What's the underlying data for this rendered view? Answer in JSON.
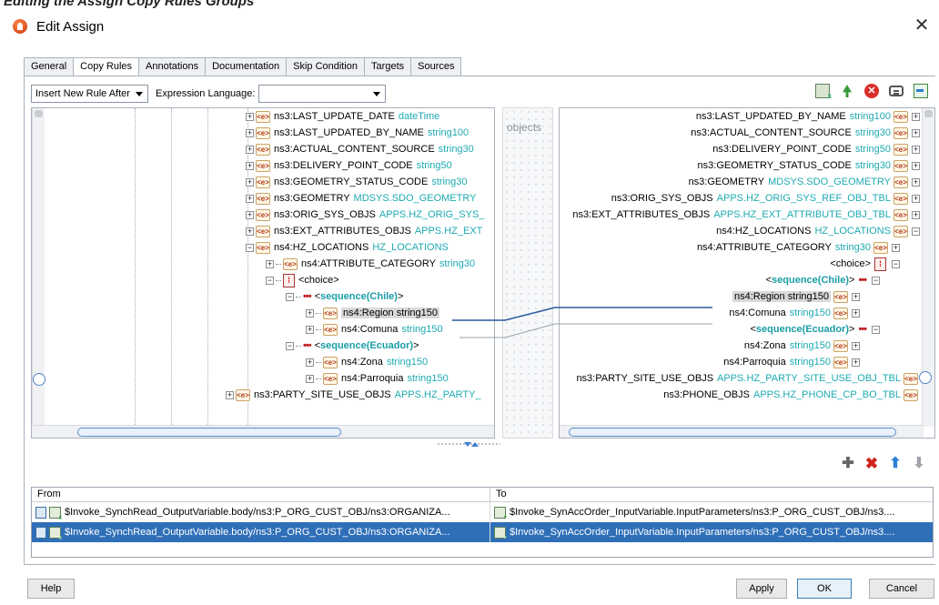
{
  "caption": "Editing the Assign Copy Rules Groups",
  "window": {
    "title": "Edit Assign",
    "close_glyph": "✕"
  },
  "tabs": [
    "General",
    "Copy Rules",
    "Annotations",
    "Documentation",
    "Skip Condition",
    "Targets",
    "Sources"
  ],
  "active_tab": "Copy Rules",
  "toolbar": {
    "insert_mode": "Insert New Rule After",
    "expression_language_label": "Expression Language:",
    "expression_language_value": ""
  },
  "middle": {
    "label": "objects"
  },
  "source_tree": [
    {
      "name": "ns3:LAST_UPDATE_DATE",
      "type": "dateTime"
    },
    {
      "name": "ns3:LAST_UPDATED_BY_NAME",
      "type": "string100"
    },
    {
      "name": "ns3:ACTUAL_CONTENT_SOURCE",
      "type": "string30"
    },
    {
      "name": "ns3:DELIVERY_POINT_CODE",
      "type": "string50"
    },
    {
      "name": "ns3:GEOMETRY_STATUS_CODE",
      "type": "string30"
    },
    {
      "name": "ns3:GEOMETRY",
      "type": "MDSYS.SDO_GEOMETRY"
    },
    {
      "name": "ns3:ORIG_SYS_OBJS",
      "type": "APPS.HZ_ORIG_SYS_"
    },
    {
      "name": "ns3:EXT_ATTRIBUTES_OBJS",
      "type": "APPS.HZ_EXT"
    },
    {
      "name": "ns4:HZ_LOCATIONS",
      "type": "HZ_LOCATIONS"
    },
    {
      "name": "ns4:ATTRIBUTE_CATEGORY",
      "type": "string30"
    },
    {
      "name": "<choice>",
      "type": ""
    },
    {
      "name": "<sequence(Chile)>",
      "type": ""
    },
    {
      "name": "ns4:Region",
      "type": "string150"
    },
    {
      "name": "ns4:Comuna",
      "type": "string150"
    },
    {
      "name": "<sequence(Ecuador)>",
      "type": ""
    },
    {
      "name": "ns4:Zona",
      "type": "string150"
    },
    {
      "name": "ns4:Parroquia",
      "type": "string150"
    },
    {
      "name": "ns3:PARTY_SITE_USE_OBJS",
      "type": "APPS.HZ_PARTY_"
    }
  ],
  "target_tree": [
    {
      "name": "ns3:LAST_UPDATED_BY_NAME",
      "type": "string100"
    },
    {
      "name": "ns3:ACTUAL_CONTENT_SOURCE",
      "type": "string30"
    },
    {
      "name": "ns3:DELIVERY_POINT_CODE",
      "type": "string50"
    },
    {
      "name": "ns3:GEOMETRY_STATUS_CODE",
      "type": "string30"
    },
    {
      "name": "ns3:GEOMETRY",
      "type": "MDSYS.SDO_GEOMETRY"
    },
    {
      "name": "ns3:ORIG_SYS_OBJS",
      "type": "APPS.HZ_ORIG_SYS_REF_OBJ_TBL"
    },
    {
      "name": "ns3:EXT_ATTRIBUTES_OBJS",
      "type": "APPS.HZ_EXT_ATTRIBUTE_OBJ_TBL"
    },
    {
      "name": "ns4:HZ_LOCATIONS",
      "type": "HZ_LOCATIONS"
    },
    {
      "name": "ns4:ATTRIBUTE_CATEGORY",
      "type": "string30"
    },
    {
      "name": "<choice>",
      "type": ""
    },
    {
      "name": "<sequence(Chile)>",
      "type": ""
    },
    {
      "name": "ns4:Region",
      "type": "string150"
    },
    {
      "name": "ns4:Comuna",
      "type": "string150"
    },
    {
      "name": "<sequence(Ecuador)>",
      "type": ""
    },
    {
      "name": "ns4:Zona",
      "type": "string150"
    },
    {
      "name": "ns4:Parroquia",
      "type": "string150"
    },
    {
      "name": "ns3:PARTY_SITE_USE_OBJS",
      "type": "APPS.HZ_PARTY_SITE_USE_OBJ_TBL"
    },
    {
      "name": "ns3:PHONE_OBJS",
      "type": "APPS.HZ_PHONE_CP_BO_TBL"
    }
  ],
  "rules_table": {
    "headers": {
      "from": "From",
      "to": "To"
    },
    "rows": [
      {
        "from": "$Invoke_SynchRead_OutputVariable.body/ns3:P_ORG_CUST_OBJ/ns3:ORGANIZA...",
        "to": "$Invoke_SynAccOrder_InputVariable.InputParameters/ns3:P_ORG_CUST_OBJ/ns3...."
      },
      {
        "from": "$Invoke_SynchRead_OutputVariable.body/ns3:P_ORG_CUST_OBJ/ns3:ORGANIZA...",
        "to": "$Invoke_SynAccOrder_InputVariable.InputParameters/ns3:P_ORG_CUST_OBJ/ns3...."
      }
    ]
  },
  "buttons": {
    "help": "Help",
    "apply": "Apply",
    "ok": "OK",
    "cancel": "Cancel"
  },
  "colors": {
    "type_text": "#1eaab1",
    "selection": "#2f6fb8",
    "mapping_line": "#2a5a9a"
  },
  "icons": [
    "edit-assign-icon",
    "close-icon",
    "show-rules-icon",
    "expand-tree-icon",
    "delete-rule-icon",
    "properties-icon",
    "auto-map-icon",
    "add-rule-icon",
    "remove-rule-icon",
    "move-up-icon",
    "move-down-icon"
  ]
}
